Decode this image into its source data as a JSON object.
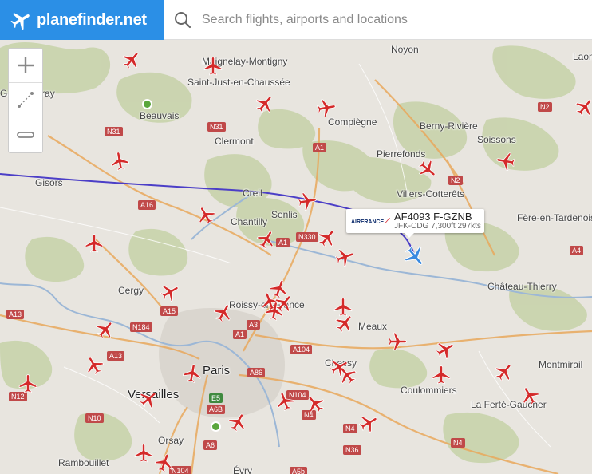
{
  "header": {
    "brand": "planefinder.net",
    "search_placeholder": "Search flights, airports and locations"
  },
  "controls": {
    "zoom_in_icon": "plus-icon",
    "measure_icon": "measure-icon",
    "zoom_out_icon": "minus-icon"
  },
  "map": {
    "places": [
      "Noyon",
      "Maignelay-Montigny",
      "Saint-Just-en-Chaussée",
      "Beauvais",
      "Compiègne",
      "Berny-Rivière",
      "Soissons",
      "Clermont",
      "Pierrefonds",
      "Gisors",
      "Creil",
      "Villers-Cotterêts",
      "Chantilly",
      "Senlis",
      "Fère-en-Tardenois",
      "Cergy",
      "Château-Thierry",
      "Roissy-en-France",
      "Meaux",
      "Paris",
      "Chessy",
      "Montmirail",
      "Coulommiers",
      "Versailles",
      "La Ferté-Gaucher",
      "Orsay",
      "Rambouillet",
      "Évry",
      "Gou-en-Bray",
      "Laon"
    ],
    "roads": [
      "N31",
      "N31",
      "A1",
      "N2",
      "N2",
      "A16",
      "N330",
      "A1",
      "A15",
      "A3",
      "A1",
      "N184",
      "A13",
      "A13",
      "A104",
      "A86",
      "A4",
      "N2",
      "N12",
      "E5",
      "A6B",
      "N104",
      "N4",
      "N4",
      "N10",
      "A6",
      "N36",
      "N4",
      "N104",
      "A5b",
      "A4"
    ],
    "selected_flight": {
      "airline": "AIRFRANCE",
      "callsign": "AF4093 F-GZNB",
      "details": "JFK-CDG 7,300ft 297kts"
    },
    "colors": {
      "aircraft": "#d42a2a",
      "selected_aircraft": "#3a8ae0",
      "flight_path": "#4b3ec7",
      "brand": "#2b8fe6",
      "forest": "#c5d1a6"
    }
  }
}
